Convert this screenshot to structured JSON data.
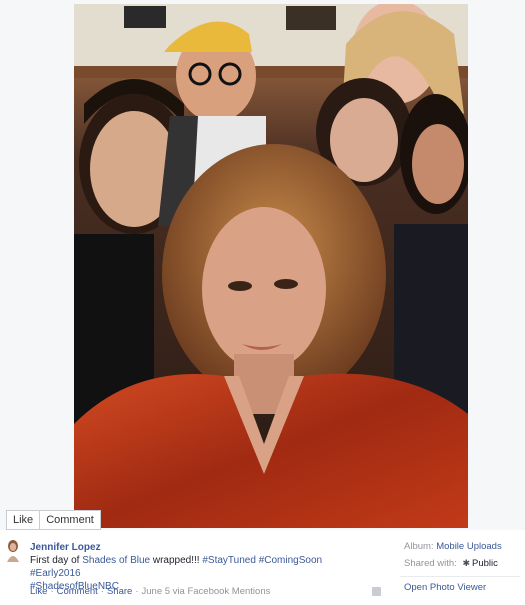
{
  "photo": {
    "description_icon": "group-selfie-photo",
    "actions": {
      "like_label": "Like",
      "comment_label": "Comment"
    }
  },
  "post": {
    "author": "Jennifer Lopez",
    "caption_prefix": "First day of ",
    "caption_link": "Shades of Blue",
    "caption_middle": " wrapped!!! ",
    "hashtags": [
      "#StayTuned",
      "#ComingSoon",
      "#Early2016",
      "#ShadesofBlueNBC"
    ],
    "actions": {
      "like": "Like",
      "comment": "Comment",
      "share": "Share",
      "meta": "June 5 via Facebook Mentions"
    }
  },
  "sidebar": {
    "album_label": "Album:",
    "album_value": "Mobile Uploads",
    "shared_label": "Shared with:",
    "shared_value": "Public",
    "open_viewer": "Open Photo Viewer"
  },
  "colors": {
    "link": "#3b5998",
    "muted": "#90949c",
    "text": "#1d2129"
  }
}
